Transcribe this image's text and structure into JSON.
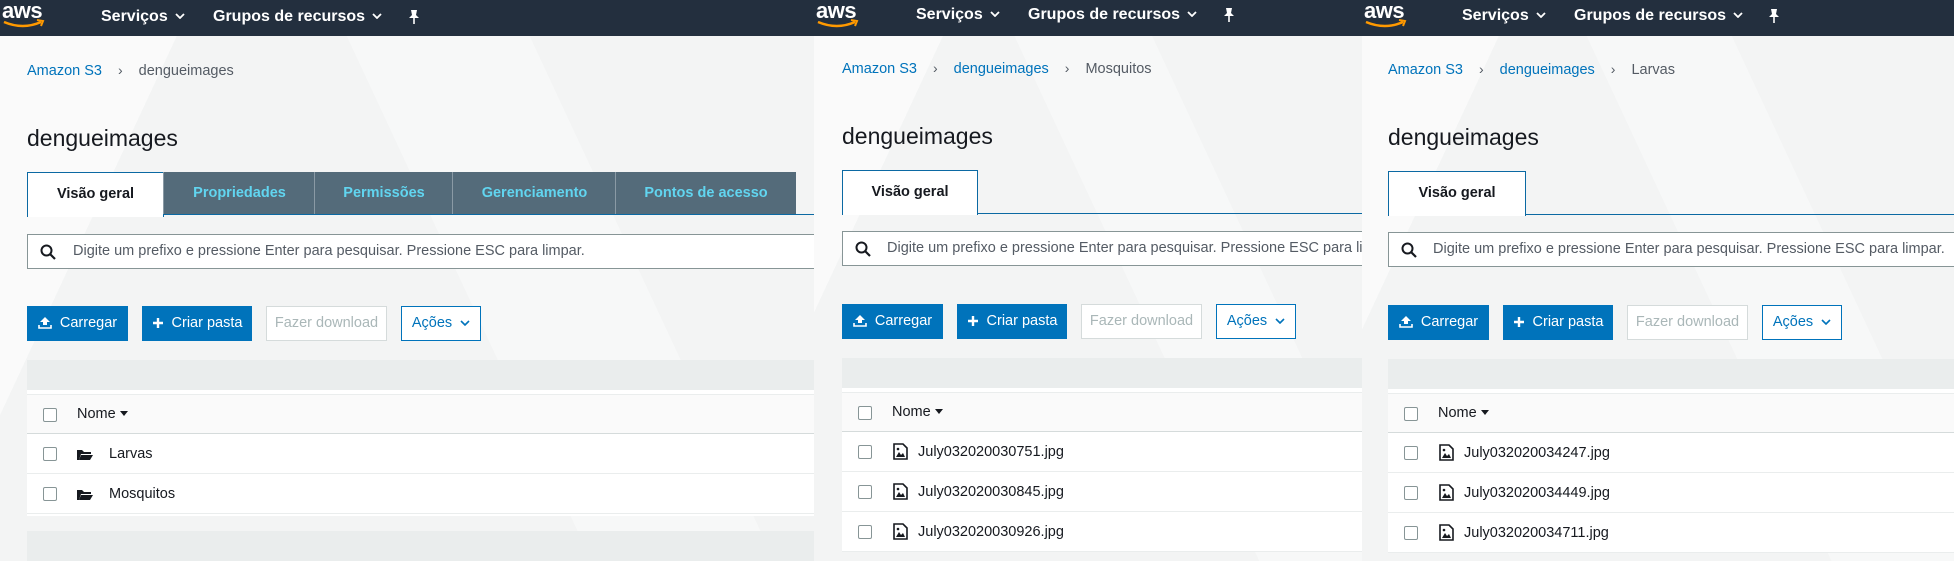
{
  "nav": {
    "logo": "aws",
    "services": "Serviços",
    "resource_groups": "Grupos de recursos"
  },
  "panels": [
    {
      "breadcrumb": {
        "root": "Amazon S3",
        "bucket": "dengueimages",
        "folder": ""
      },
      "title": "dengueimages",
      "tabs": [
        "Visão geral",
        "Propriedades",
        "Permissões",
        "Gerenciamento",
        "Pontos de acesso"
      ],
      "search_placeholder": "Digite um prefixo e pressione Enter para pesquisar. Pressione ESC para limpar.",
      "buttons": {
        "upload": "Carregar",
        "create_folder": "Criar pasta",
        "download": "Fazer download",
        "actions": "Ações"
      },
      "column_name": "Nome",
      "rows": [
        {
          "name": "Larvas",
          "type": "folder"
        },
        {
          "name": "Mosquitos",
          "type": "folder"
        }
      ]
    },
    {
      "breadcrumb": {
        "root": "Amazon S3",
        "bucket": "dengueimages",
        "folder": "Mosquitos"
      },
      "title": "dengueimages",
      "tabs": [
        "Visão geral"
      ],
      "search_placeholder": "Digite um prefixo e pressione Enter para pesquisar. Pressione ESC para limpar.",
      "buttons": {
        "upload": "Carregar",
        "create_folder": "Criar pasta",
        "download": "Fazer download",
        "actions": "Ações"
      },
      "column_name": "Nome",
      "rows": [
        {
          "name": "July032020030751.jpg",
          "type": "image"
        },
        {
          "name": "July032020030845.jpg",
          "type": "image"
        },
        {
          "name": "July032020030926.jpg",
          "type": "image"
        }
      ]
    },
    {
      "breadcrumb": {
        "root": "Amazon S3",
        "bucket": "dengueimages",
        "folder": "Larvas"
      },
      "title": "dengueimages",
      "tabs": [
        "Visão geral"
      ],
      "search_placeholder": "Digite um prefixo e pressione Enter para pesquisar. Pressione ESC para limpar.",
      "buttons": {
        "upload": "Carregar",
        "create_folder": "Criar pasta",
        "download": "Fazer download",
        "actions": "Ações"
      },
      "column_name": "Nome",
      "rows": [
        {
          "name": "July032020034247.jpg",
          "type": "image"
        },
        {
          "name": "July032020034449.jpg",
          "type": "image"
        },
        {
          "name": "July032020034711.jpg",
          "type": "image"
        }
      ]
    }
  ]
}
